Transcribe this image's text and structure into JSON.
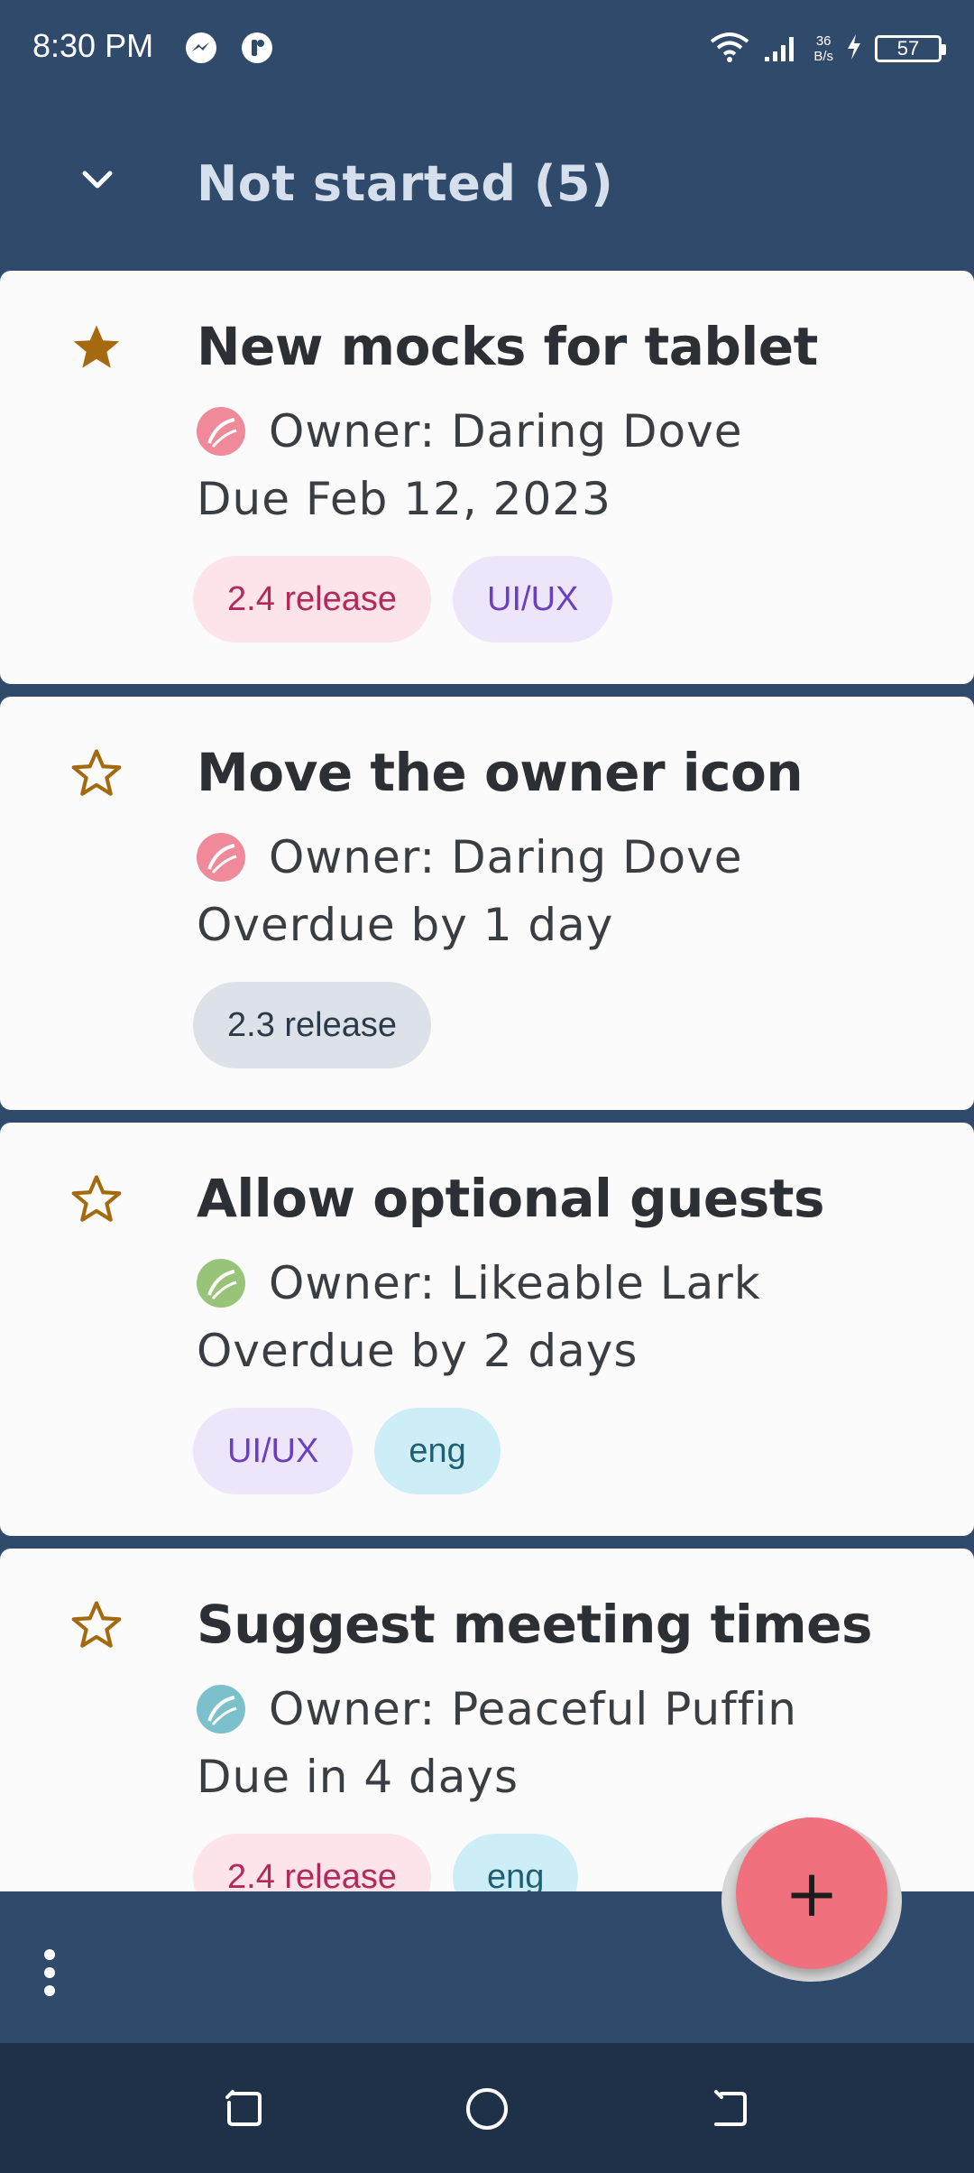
{
  "status_bar": {
    "time": "8:30 PM",
    "net_speed_value": "36",
    "net_speed_unit": "B/s",
    "battery": "57",
    "icons": [
      "messenger-icon",
      "app-notification-icon",
      "wifi-icon",
      "signal-icon",
      "charging-icon"
    ]
  },
  "header": {
    "section_title": "Not started (5)",
    "collapse_icon": "chevron-down-icon"
  },
  "tasks": [
    {
      "title": "New mocks for tablet",
      "starred": true,
      "owner": "Owner: Daring Dove",
      "avatar_color": "#f08a9a",
      "due": "Due Feb 12, 2023",
      "tags": [
        {
          "label": "2.4 release",
          "bg": "#fde4ea",
          "fg": "#b5285a"
        },
        {
          "label": "UI/UX",
          "bg": "#ede6fb",
          "fg": "#6b3fbf"
        }
      ]
    },
    {
      "title": "Move the owner icon",
      "starred": false,
      "owner": "Owner: Daring Dove",
      "avatar_color": "#f08a9a",
      "due": "Overdue by 1 day",
      "tags": [
        {
          "label": "2.3 release",
          "bg": "#dde2e8",
          "fg": "#2b3a4a"
        }
      ]
    },
    {
      "title": "Allow optional guests",
      "starred": false,
      "owner": "Owner: Likeable Lark",
      "avatar_color": "#98c47a",
      "due": "Overdue by 2 days",
      "tags": [
        {
          "label": "UI/UX",
          "bg": "#ede6fb",
          "fg": "#6b3fbf"
        },
        {
          "label": "eng",
          "bg": "#cdeef6",
          "fg": "#1f5f73"
        }
      ]
    },
    {
      "title": "Suggest meeting times",
      "starred": false,
      "owner": "Owner: Peaceful Puffin",
      "avatar_color": "#7cc0cc",
      "due": "Due in 4 days",
      "tags": [
        {
          "label": "2.4 release",
          "bg": "#fde4ea",
          "fg": "#b5285a"
        },
        {
          "label": "eng",
          "bg": "#cdeef6",
          "fg": "#1f5f73"
        }
      ]
    }
  ],
  "colors": {
    "background": "#2f4a6b",
    "card": "#fbfbfb",
    "star": "#a56a10",
    "fab": "#f0707e",
    "navbar": "#1f3148"
  },
  "fab": {
    "label": "+",
    "icon": "plus-icon"
  },
  "app_bar": {
    "menu_icon": "more-vert-icon"
  },
  "nav_bar": {
    "buttons": [
      "recents-icon",
      "home-icon",
      "back-icon"
    ]
  }
}
